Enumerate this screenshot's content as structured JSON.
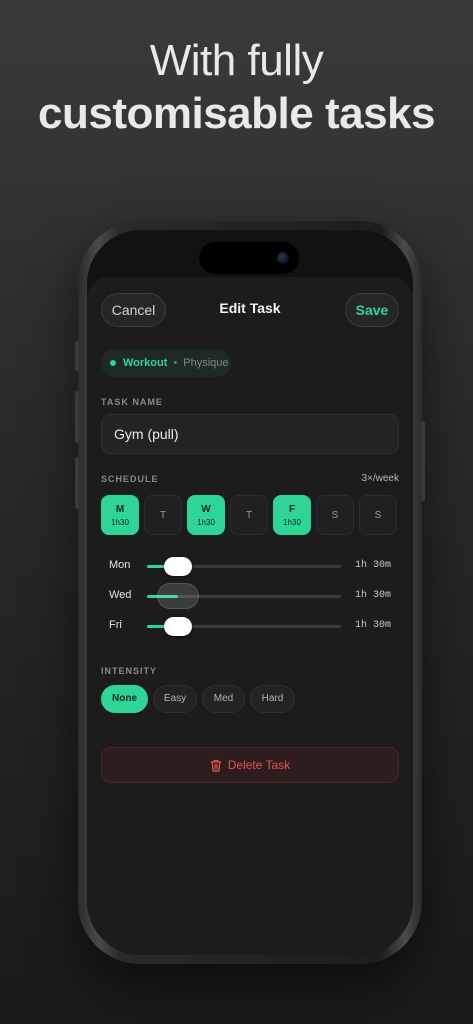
{
  "headline": {
    "line1": "With fully",
    "line2": "customisable tasks"
  },
  "nav": {
    "cancel": "Cancel",
    "title": "Edit Task",
    "save": "Save"
  },
  "category": {
    "primary": "Workout",
    "separator": "•",
    "secondary": "Physique"
  },
  "task_name": {
    "label": "TASK NAME",
    "value": "Gym (pull)"
  },
  "schedule": {
    "label": "SCHEDULE",
    "frequency": "3×/week",
    "days": [
      {
        "day": "M",
        "time": "1h30",
        "selected": true
      },
      {
        "day": "T",
        "time": "",
        "selected": false
      },
      {
        "day": "W",
        "time": "1h30",
        "selected": true
      },
      {
        "day": "T",
        "time": "",
        "selected": false
      },
      {
        "day": "F",
        "time": "1h30",
        "selected": true
      },
      {
        "day": "S",
        "time": "",
        "selected": false
      },
      {
        "day": "S",
        "time": "",
        "selected": false
      }
    ],
    "durations": [
      {
        "name": "Mon",
        "value": "1h 30m",
        "level": 0.16
      },
      {
        "name": "Wed",
        "value": "1h 30m",
        "level": 0.16
      },
      {
        "name": "Fri",
        "value": "1h 30m",
        "level": 0.16
      }
    ]
  },
  "intensity": {
    "label": "INTENSITY",
    "options": [
      "None",
      "Easy",
      "Med",
      "Hard"
    ],
    "selected": "None"
  },
  "delete_label": "Delete Task",
  "colors": {
    "accent": "#2fd597",
    "danger": "#e8514f",
    "sheet": "#1c1c1d"
  },
  "icons": {
    "delete": "trash-icon"
  }
}
